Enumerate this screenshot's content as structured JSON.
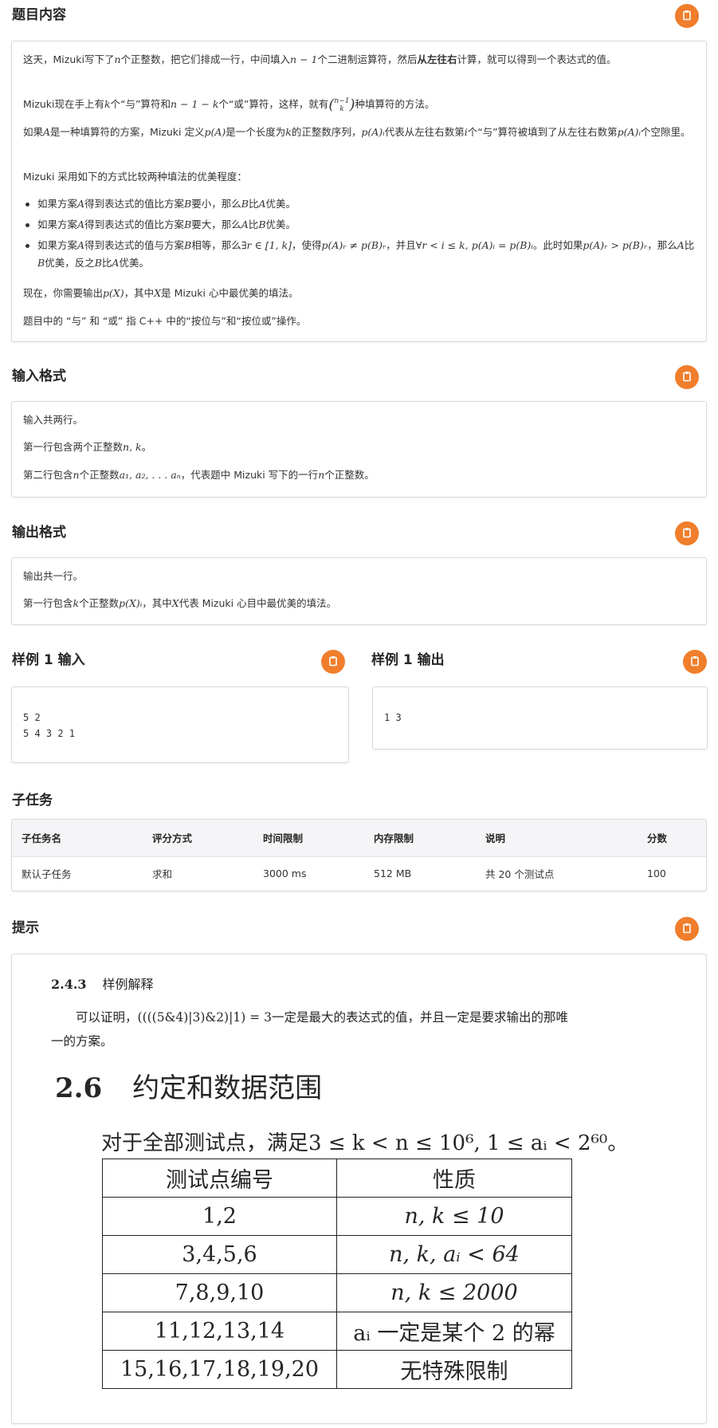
{
  "colors": {
    "accent": "#f07e2c",
    "card_border": "#d9d9d9"
  },
  "icons": {
    "copy": "clipboard-icon"
  },
  "sections": {
    "content": "题目内容",
    "input": "输入格式",
    "output": "输出格式",
    "sample_in": "样例 1 输入",
    "sample_out": "样例 1 输出",
    "subtasks": "子任务",
    "hint": "提示"
  },
  "content": {
    "p1a": "这天，Mizuki写下了",
    "p1b": "n",
    "p1c": "个正整数，把它们排成一行，中间填入",
    "p1d": "n − 1",
    "p1e": "个二进制运算符，然后",
    "p1f": "从左往右",
    "p1g": "计算，就可以得到一个表达式的值。",
    "p2a": "Mizuki现在手上有",
    "p2b": "k",
    "p2c": "个“与”算符和",
    "p2d": "n − 1 − k",
    "p2e": "个“或”算符，这样，就有",
    "p2top": "n−1",
    "p2bot": "k",
    "p2f": "种填算符的方法。",
    "p3a": "如果",
    "p3b": "A",
    "p3c": "是一种填算符的方案，Mizuki 定义",
    "p3d": "p(A)",
    "p3e": "是一个长度为",
    "p3f": "k",
    "p3g": "的正整数序列，",
    "p3h": "p(A)ᵢ",
    "p3i": "代表从左往右数第",
    "p3j": "i",
    "p3k": "个“与”算符被填到了从左往右数第",
    "p3l": "p(A)ᵢ",
    "p3m": "个空隙里。",
    "p4": "Mizuki 采用如下的方式比较两种填法的优美程度：",
    "b1a": "如果方案",
    "b1b": "A",
    "b1c": "得到表达式的值比方案",
    "b1d": "B",
    "b1e": "要小，那么",
    "b1f": "B",
    "b1g": "比",
    "b1h": "A",
    "b1i": "优美。",
    "b2a": "如果方案",
    "b2b": "A",
    "b2c": "得到表达式的值比方案",
    "b2d": "B",
    "b2e": "要大，那么",
    "b2f": "A",
    "b2g": "比",
    "b2h": "B",
    "b2i": "优美。",
    "b3a": "如果方案",
    "b3b": "A",
    "b3c": "得到表达式的值与方案",
    "b3d": "B",
    "b3e": "相等，那么",
    "b3f": "∃r ∈ [1, k]",
    "b3g": "，使得",
    "b3h": "p(A)ᵣ ≠ p(B)ᵣ",
    "b3i": "，并且",
    "b3j": "∀r < i ≤ k, p(A)ᵢ = p(B)ᵢ",
    "b3k": "。此时如果",
    "b3l": "p(A)ᵣ > p(B)ᵣ",
    "b3m": "，那么",
    "b3n": "A",
    "b3o": "比",
    "b3p": "B",
    "b3q": "优美，反之",
    "b3r": "B",
    "b3s": "比",
    "b3t": "A",
    "b3u": "优美。",
    "p5a": "现在，你需要输出",
    "p5b": "p(X)",
    "p5c": "，其中",
    "p5d": "X",
    "p5e": "是 Mizuki 心中最优美的填法。",
    "p6": "题目中的 “与” 和 “或” 指 C++ 中的“按位与”和“按位或”操作。"
  },
  "input": {
    "l1": "输入共两行。",
    "l2a": "第一行包含两个正整数",
    "l2b": "n, k",
    "l2c": "。",
    "l3a": "第二行包含",
    "l3b": "n",
    "l3c": "个正整数",
    "l3d": "a₁, a₂, . . . aₙ",
    "l3e": "，代表题中 Mizuki 写下的一行",
    "l3f": "n",
    "l3g": "个正整数。"
  },
  "output": {
    "l1": "输出共一行。",
    "l2a": "第一行包含",
    "l2b": "k",
    "l2c": "个正整数",
    "l2d": "p(X)ᵢ",
    "l2e": "，其中",
    "l2f": "X",
    "l2g": "代表 Mizuki 心目中最优美的填法。"
  },
  "sample": {
    "in1": "5 2",
    "in2": "5 4 3 2 1",
    "out1": "1 3"
  },
  "subtask_table": {
    "headers": [
      "子任务名",
      "评分方式",
      "时间限制",
      "内存限制",
      "说明",
      "分数"
    ],
    "row": [
      "默认子任务",
      "求和",
      "3000 ms",
      "512 MB",
      "共 20 个测试点",
      "100"
    ]
  },
  "hint": {
    "h3_num": "2.4.3",
    "h3_title": "样例解释",
    "expl1a": "可以证明，",
    "expl1b": "((((5&4)|3)&2)|1) = 3",
    "expl1c": "一定是最大的表达式的值，并且一定是要求输出的那唯",
    "expl2": "一的方案。",
    "h2_num": "2.6",
    "h2_title": "约定和数据范围",
    "cons_a": "对于全部测试点，满足",
    "cons_b": "3 ≤ k < n ≤ 10⁶, 1 ≤ aᵢ < 2⁶⁰",
    "cons_c": "。",
    "table_headers": [
      "测试点编号",
      "性质"
    ],
    "rows": [
      [
        "1,2",
        "n, k ≤ 10"
      ],
      [
        "3,4,5,6",
        "n, k, aᵢ < 64"
      ],
      [
        "7,8,9,10",
        "n, k ≤ 2000"
      ],
      [
        "11,12,13,14",
        "aᵢ 一定是某个 2 的幂"
      ],
      [
        "15,16,17,18,19,20",
        "无特殊限制"
      ]
    ]
  }
}
